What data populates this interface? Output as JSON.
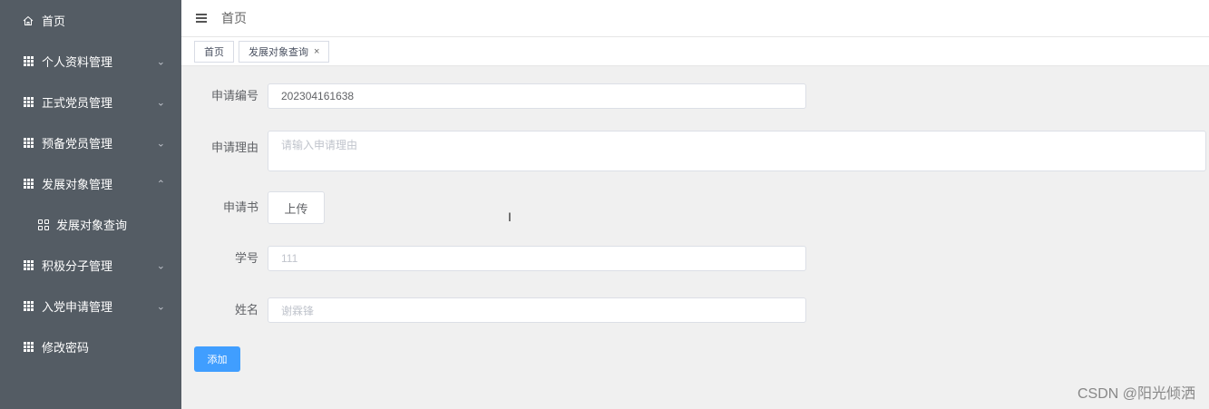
{
  "sidebar": {
    "items": [
      {
        "label": "首页",
        "icon": "home-icon",
        "chevron": ""
      },
      {
        "label": "个人资料管理",
        "icon": "grid-icon",
        "chevron": "⌄"
      },
      {
        "label": "正式党员管理",
        "icon": "grid-icon",
        "chevron": "⌄"
      },
      {
        "label": "预备党员管理",
        "icon": "grid-icon",
        "chevron": "⌄"
      },
      {
        "label": "发展对象管理",
        "icon": "grid-icon",
        "chevron": "⌃"
      },
      {
        "label": "积极分子管理",
        "icon": "grid-icon",
        "chevron": "⌄"
      },
      {
        "label": "入党申请管理",
        "icon": "grid-icon",
        "chevron": "⌄"
      },
      {
        "label": "修改密码",
        "icon": "grid-icon",
        "chevron": ""
      }
    ],
    "submenu": {
      "label": "发展对象查询",
      "icon": "apps-icon"
    }
  },
  "header": {
    "title": "首页",
    "icon": "menu-fold-icon"
  },
  "tags": [
    {
      "label": "首页"
    },
    {
      "label": "发展对象查询",
      "close": "×"
    }
  ],
  "form": {
    "application_no": {
      "label": "申请编号",
      "value": "202304161638"
    },
    "reason": {
      "label": "申请理由",
      "placeholder": "请输入申请理由"
    },
    "letter": {
      "label": "申请书",
      "button": "上传"
    },
    "student_id": {
      "label": "学号",
      "value": "111"
    },
    "name": {
      "label": "姓名",
      "value": "谢霖锋"
    },
    "submit": "添加"
  },
  "watermark": "CSDN @阳光倾洒",
  "colors": {
    "sidebar_bg": "#545c64",
    "primary": "#409eff",
    "content_bg": "#f0f0f0"
  }
}
